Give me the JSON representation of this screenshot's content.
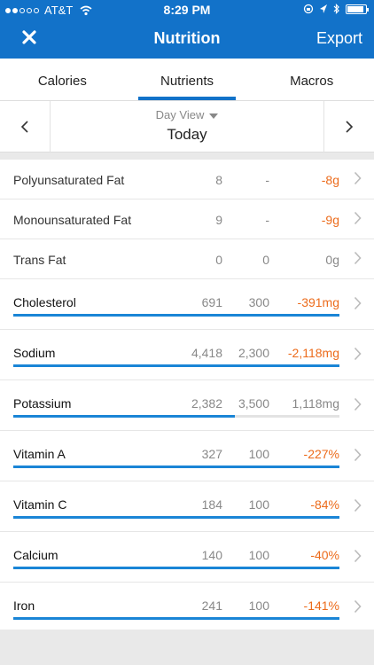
{
  "status_bar": {
    "carrier": "AT&T",
    "time": "8:29 PM",
    "battery_level": 0.9
  },
  "nav": {
    "title": "Nutrition",
    "export_label": "Export"
  },
  "tabs": [
    {
      "label": "Calories",
      "active": false
    },
    {
      "label": "Nutrients",
      "active": true
    },
    {
      "label": "Macros",
      "active": false
    }
  ],
  "day": {
    "view_label": "Day View",
    "value": "Today"
  },
  "nutrients": [
    {
      "name": "Polyunsaturated Fat",
      "total": "8",
      "goal": "-",
      "left": "-8g",
      "over": true,
      "bar": null
    },
    {
      "name": "Monounsaturated Fat",
      "total": "9",
      "goal": "-",
      "left": "-9g",
      "over": true,
      "bar": null
    },
    {
      "name": "Trans Fat",
      "total": "0",
      "goal": "0",
      "left": "0g",
      "over": false,
      "bar": null
    },
    {
      "name": "Cholesterol",
      "total": "691",
      "goal": "300",
      "left": "-391mg",
      "over": true,
      "bar": 1.0
    },
    {
      "name": "Sodium",
      "total": "4,418",
      "goal": "2,300",
      "left": "-2,118mg",
      "over": true,
      "bar": 1.0
    },
    {
      "name": "Potassium",
      "total": "2,382",
      "goal": "3,500",
      "left": "1,118mg",
      "over": false,
      "bar": 0.68
    },
    {
      "name": "Vitamin A",
      "total": "327",
      "goal": "100",
      "left": "-227%",
      "over": true,
      "bar": 1.0
    },
    {
      "name": "Vitamin C",
      "total": "184",
      "goal": "100",
      "left": "-84%",
      "over": true,
      "bar": 1.0
    },
    {
      "name": "Calcium",
      "total": "140",
      "goal": "100",
      "left": "-40%",
      "over": true,
      "bar": 1.0
    },
    {
      "name": "Iron",
      "total": "241",
      "goal": "100",
      "left": "-141%",
      "over": true,
      "bar": 1.0
    }
  ],
  "colors": {
    "brand": "#1272c9",
    "bar": "#1a85d6",
    "over": "#ec6b1b"
  }
}
